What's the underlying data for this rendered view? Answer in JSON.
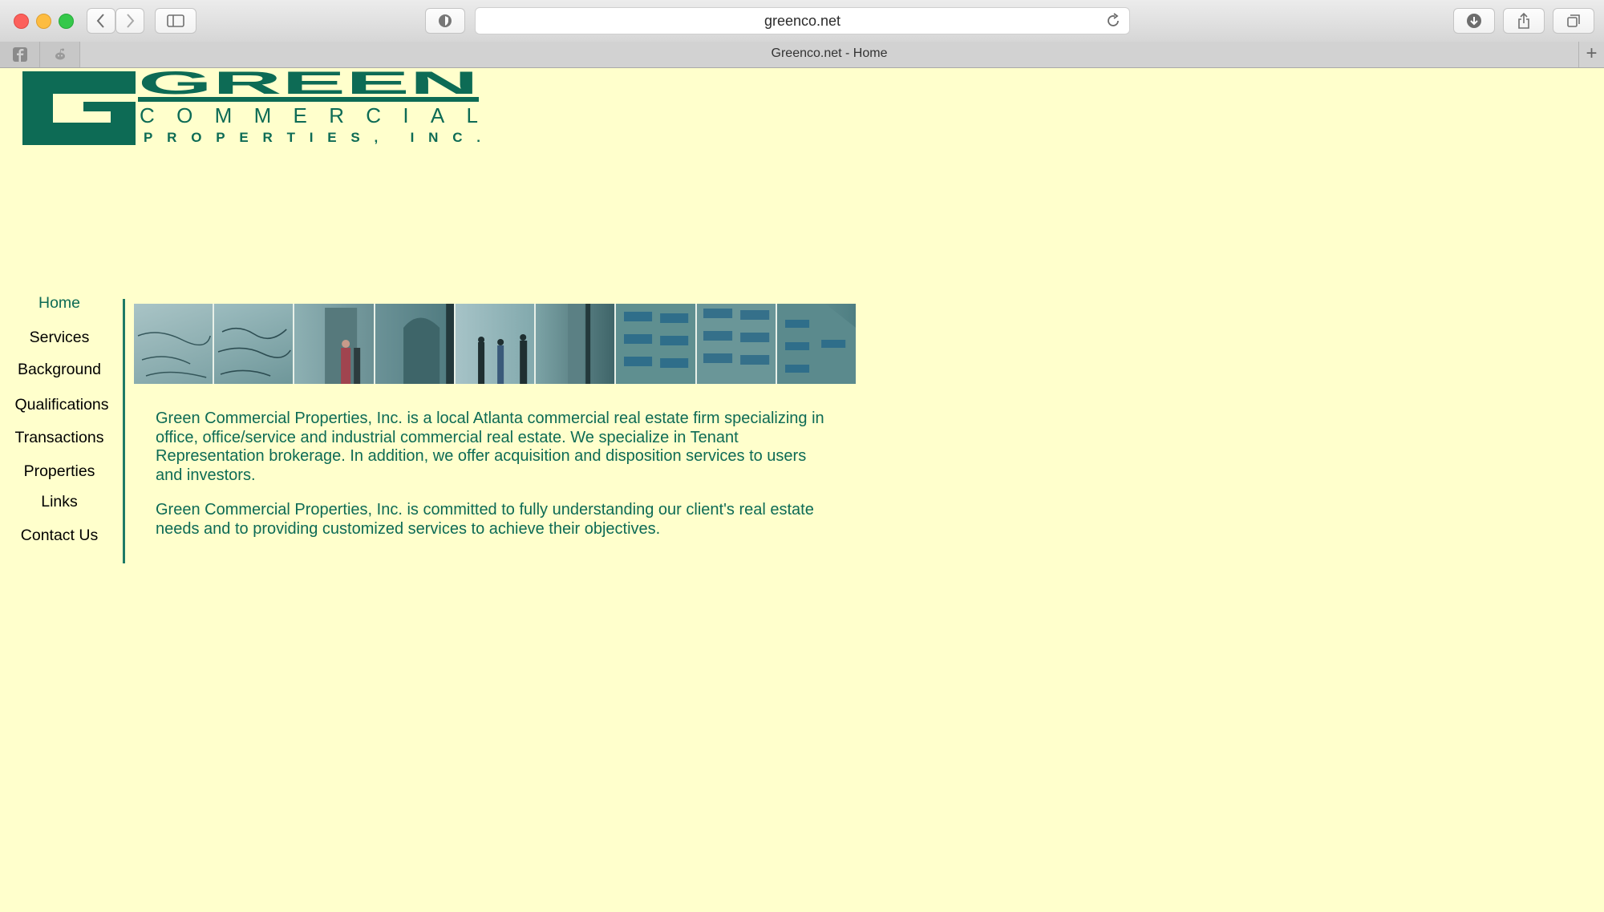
{
  "browser": {
    "url": "greenco.net",
    "tab_title": "Greenco.net - Home",
    "pinned_tabs": [
      {
        "icon": "facebook-icon"
      },
      {
        "icon": "reddit-icon"
      }
    ],
    "buttons": {
      "back": "chevron-left-icon",
      "forward": "chevron-right-icon",
      "sidebar": "sidebar-icon",
      "shield": "privacy-shield-icon",
      "reload": "reload-icon",
      "download": "download-icon",
      "share": "share-icon",
      "tabs": "tabs-overview-icon",
      "new_tab": "+"
    }
  },
  "logo": {
    "text": "GREEN COMMERCIAL PROPERTIES, INC.",
    "word1": "GREEN",
    "word2": "COMMERCIAL",
    "word3": "PROPERTIES, INC.",
    "color": "#0d6b55"
  },
  "nav": {
    "items": [
      {
        "label": "Home",
        "active": true
      },
      {
        "label": "Services",
        "active": false
      },
      {
        "label": "Background",
        "active": false
      },
      {
        "label": "Qualifications",
        "active": false
      },
      {
        "label": "Transactions",
        "active": false
      },
      {
        "label": "Properties",
        "active": false
      },
      {
        "label": "Links",
        "active": false
      },
      {
        "label": "Contact Us",
        "active": false
      }
    ]
  },
  "content": {
    "paragraph1": "Green Commercial Properties, Inc. is a local Atlanta commercial real estate firm specializing in office, office/service and industrial commercial real estate. We specialize in Tenant Representation brokerage. In addition, we offer acquisition and disposition services to users and investors.",
    "paragraph2": "Green Commercial Properties, Inc. is committed to fully understanding our client's real estate needs and to providing customized services to achieve their objectives."
  },
  "colors": {
    "page_background": "#ffffcc",
    "brand_green": "#0d6b55",
    "banner_teal": "#5f8f90"
  }
}
